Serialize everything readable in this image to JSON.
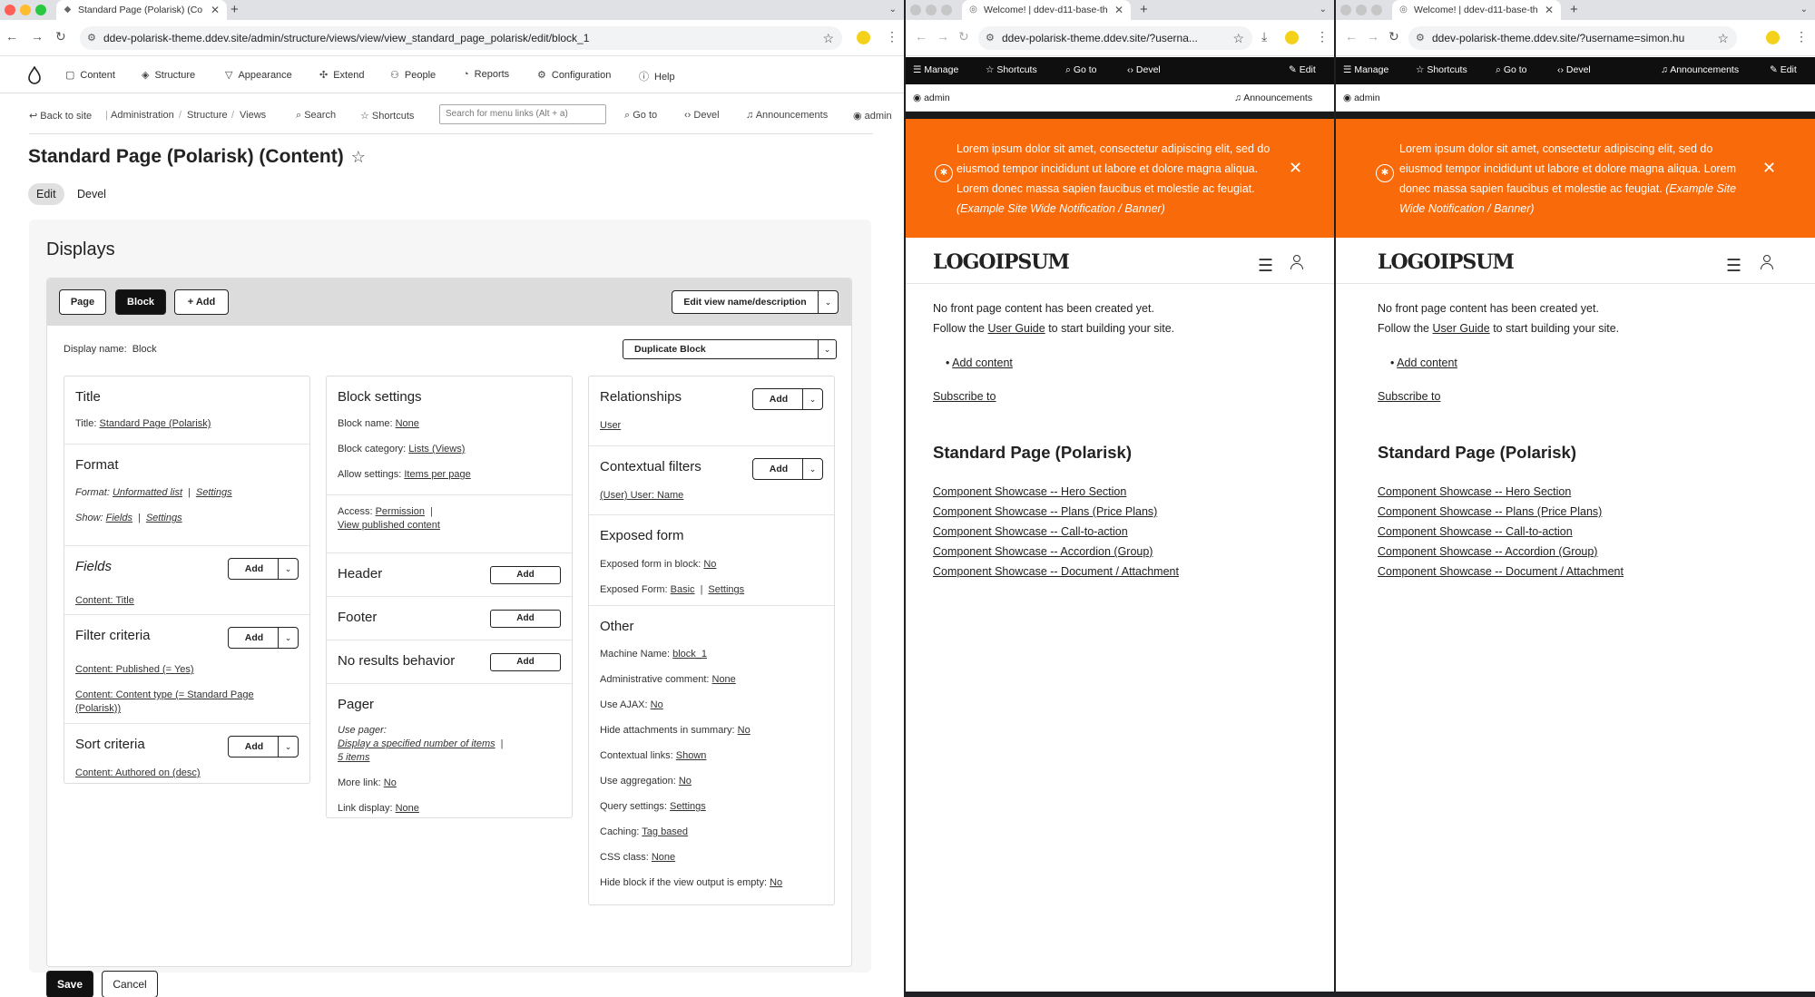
{
  "admin_window": {
    "tab_title": "Standard Page (Polarisk) (Co",
    "url": "ddev-polarisk-theme.ddev.site/admin/structure/views/view/view_standard_page_polarisk/edit/block_1",
    "toolbar": [
      "Content",
      "Structure",
      "Appearance",
      "Extend",
      "People",
      "Reports",
      "Configuration",
      "Help"
    ],
    "breadcrumb": {
      "back": "Back to site",
      "items": [
        "Administration",
        "Structure",
        "Views"
      ],
      "search": "Search",
      "shortcuts": "Shortcuts",
      "menu_search_placeholder": "Search for menu links (Alt + a)",
      "goto": "Go to",
      "devel": "Devel",
      "announcements": "Announcements",
      "user": "admin"
    },
    "page_title": "Standard Page (Polarisk) (Content)",
    "local_tabs": [
      "Edit",
      "Devel"
    ],
    "displays_heading": "Displays",
    "display_tabs": {
      "page": "Page",
      "block": "Block",
      "add": "+ Add",
      "edit_name": "Edit view name/description"
    },
    "display_name_label": "Display name:",
    "display_name_value": "Block",
    "duplicate": "Duplicate Block",
    "add_label": "Add",
    "col1": {
      "title_h": "Title",
      "title_label": "Title:",
      "title_val": "Standard Page (Polarisk)",
      "format_h": "Format",
      "format_label": "Format:",
      "format_val": "Unformatted list",
      "format_settings": "Settings",
      "show_label": "Show:",
      "show_val": "Fields",
      "show_settings": "Settings",
      "fields_h": "Fields",
      "fields_val": "Content: Title",
      "filter_h": "Filter criteria",
      "filter_1": "Content: Published (= Yes)",
      "filter_2a": "Content: Content type (= Standard Page",
      "filter_2b": "(Polarisk))",
      "sort_h": "Sort criteria",
      "sort_val": "Content: Authored on (desc)"
    },
    "col2": {
      "block_h": "Block settings",
      "bname_label": "Block name:",
      "bname_val": "None",
      "bcat_label": "Block category:",
      "bcat_val": "Lists (Views)",
      "allow_label": "Allow settings:",
      "allow_val": "Items per page",
      "access_label": "Access:",
      "access_val": "Permission",
      "access_val2": "View published content",
      "header_h": "Header",
      "footer_h": "Footer",
      "nores_h": "No results behavior",
      "pager_h": "Pager",
      "pager_use": "Use pager:",
      "pager_val": "Display a specified number of items",
      "pager_items": "5 items",
      "more_label": "More link:",
      "more_val": "No",
      "linkd_label": "Link display:",
      "linkd_val": "None"
    },
    "col3": {
      "rel_h": "Relationships",
      "rel_val": "User",
      "ctx_h": "Contextual filters",
      "ctx_val": "(User) User: Name",
      "exp_h": "Exposed form",
      "exp_inblock_label": "Exposed form in block:",
      "exp_inblock_val": "No",
      "exp_form_label": "Exposed Form:",
      "exp_form_val": "Basic",
      "exp_form_settings": "Settings",
      "other_h": "Other",
      "other": [
        {
          "label": "Machine Name:",
          "val": "block_1"
        },
        {
          "label": "Administrative comment:",
          "val": "None"
        },
        {
          "label": "Use AJAX:",
          "val": "No"
        },
        {
          "label": "Hide attachments in summary:",
          "val": "No"
        },
        {
          "label": "Contextual links:",
          "val": "Shown"
        },
        {
          "label": "Use aggregation:",
          "val": "No"
        },
        {
          "label": "Query settings:",
          "val": "Settings"
        },
        {
          "label": "Caching:",
          "val": "Tag based"
        },
        {
          "label": "CSS class:",
          "val": "None"
        },
        {
          "label": "Hide block if the view output is empty:",
          "val": "No"
        }
      ]
    },
    "save": "Save",
    "cancel": "Cancel"
  },
  "front_windows": [
    {
      "tab_title": "Welcome! | ddev-d11-base-th",
      "url": "ddev-polarisk-theme.ddev.site/?userna..."
    },
    {
      "tab_title": "Welcome! | ddev-d11-base-th",
      "url": "ddev-polarisk-theme.ddev.site/?username=simon.hu"
    }
  ],
  "front": {
    "manage": "Manage",
    "shortcuts": "Shortcuts",
    "goto": "Go to",
    "devel": "Devel",
    "edit": "Edit",
    "announcements": "Announcements",
    "user": "admin",
    "banner_1": "Lorem ipsum dolor sit amet, consectetur adipiscing elit, sed do",
    "banner_2": "eiusmod tempor incididunt ut labore et dolore magna aliqua.",
    "banner_3": "Lorem donec massa sapien faucibus et molestie ac feugiat.",
    "banner_4": "(Example Site Wide Notification / Banner)",
    "banner_b1": "Lorem ipsum dolor sit amet, consectetur adipiscing elit, sed do",
    "banner_b2": "eiusmod tempor incididunt ut labore et dolore magna aliqua. Lorem",
    "banner_b3": "donec massa sapien faucibus et molestie ac feugiat.",
    "banner_b3i": "(Example Site",
    "banner_b4": "Wide Notification / Banner)",
    "logo": "LOGOIPSUM",
    "no_content": "No front page content has been created yet.",
    "follow_pre": "Follow the",
    "follow_link": "User Guide",
    "follow_post": "to start building your site.",
    "add_content": "Add content",
    "subscribe": "Subscribe to",
    "heading": "Standard Page (Polarisk)",
    "links": [
      "Component Showcase -- Hero Section",
      "Component Showcase -- Plans (Price Plans)",
      "Component Showcase -- Call-to-action",
      "Component Showcase -- Accordion (Group)",
      "Component Showcase -- Document / Attachment"
    ]
  },
  "colors": {
    "banner": "#f96a0a",
    "toolbar": "#0f0f0f",
    "accent": "#222222"
  },
  "icons": [
    "drupal-drop-icon",
    "star-icon",
    "search-icon",
    "bell-icon",
    "user-icon",
    "hamburger-icon",
    "close-icon",
    "chevron-down-icon"
  ]
}
